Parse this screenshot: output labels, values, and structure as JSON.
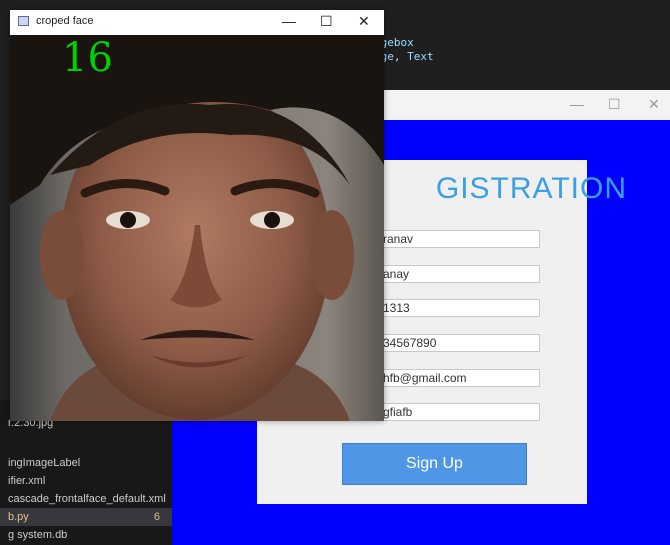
{
  "editor": {
    "code_lines": [
      "agebox",
      "age, Text"
    ],
    "explorer_items": [
      {
        "label": "r.2.30.jpg",
        "active": false
      },
      {
        "label": "ingImageLabel",
        "active": false
      },
      {
        "label": "ifier.xml",
        "active": false
      },
      {
        "label": "cascade_frontalface_default.xml",
        "active": false
      },
      {
        "label": "b.py",
        "active": true,
        "badge": "6"
      },
      {
        "label": "g system.db",
        "active": false
      }
    ]
  },
  "registration_window": {
    "titlebar_buttons": [
      "—",
      "☐",
      "✕"
    ],
    "heading": "GISTRATION",
    "fields": [
      "ranav",
      "anay",
      "1313",
      "34567890",
      "hfb@gmail.com",
      "gfiafb"
    ],
    "signup_label": "Sign Up",
    "colors": {
      "background": "#0000ff",
      "panel": "#f0f0f0",
      "heading": "#3aa0e6",
      "button": "#4f97e6"
    }
  },
  "face_window": {
    "title": "croped face",
    "titlebar_buttons": [
      "—",
      "☐",
      "✕"
    ],
    "counter": "16",
    "counter_color": "#00d200"
  }
}
